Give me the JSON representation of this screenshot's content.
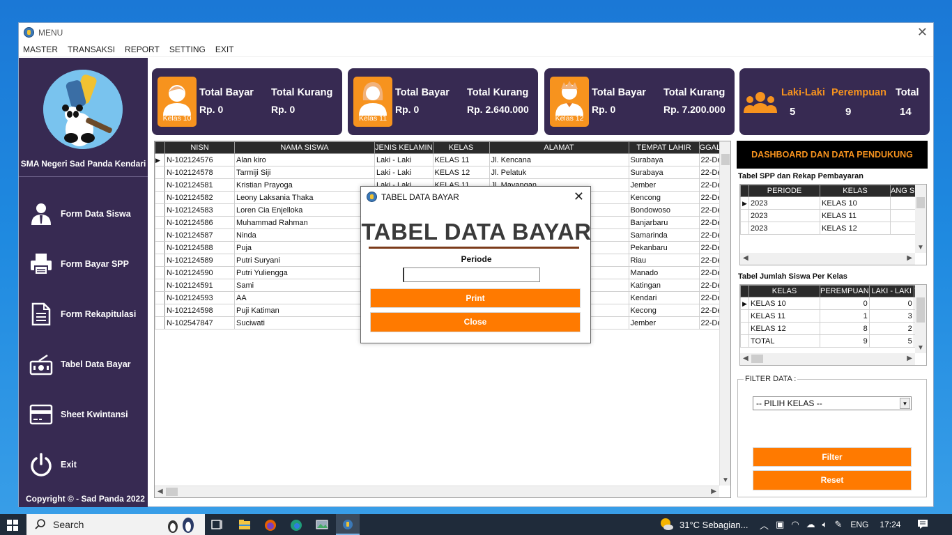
{
  "window": {
    "title": "MENU"
  },
  "menu": [
    "MASTER",
    "TRANSAKSI",
    "REPORT",
    "SETTING",
    "EXIT"
  ],
  "sidebar": {
    "school": "SMA Negeri Sad Panda Kendari",
    "items": [
      {
        "label": "Form Data Siswa",
        "icon": "user-tie-icon"
      },
      {
        "label": "Form Bayar SPP",
        "icon": "printer-icon"
      },
      {
        "label": "Form Rekapitulasi",
        "icon": "document-icon"
      },
      {
        "label": "Tabel Data Bayar",
        "icon": "cash-register-icon"
      },
      {
        "label": "Sheet Kwintansi",
        "icon": "credit-card-icon"
      },
      {
        "label": "Exit",
        "icon": "power-icon"
      }
    ],
    "copyright": "Copyright © - Sad Panda 2022"
  },
  "cards": [
    {
      "badge": "Kelas 10",
      "bayar_label": "Total Bayar",
      "bayar_val": "Rp. 0",
      "kurang_label": "Total Kurang",
      "kurang_val": "Rp. 0"
    },
    {
      "badge": "Kelas 11",
      "bayar_label": "Total Bayar",
      "bayar_val": "Rp. 0",
      "kurang_label": "Total Kurang",
      "kurang_val": "Rp. 2.640.000"
    },
    {
      "badge": "Kelas 12",
      "bayar_label": "Total Bayar",
      "bayar_val": "Rp. 0",
      "kurang_label": "Total Kurang",
      "kurang_val": "Rp. 7.200.000"
    }
  ],
  "gender": {
    "laki_label": "Laki-Laki",
    "laki_val": "5",
    "perempuan_label": "Perempuan",
    "perempuan_val": "9",
    "total_label": "Total",
    "total_val": "14"
  },
  "grid": {
    "headers": [
      "NISN",
      "NAMA SISWA",
      "JENIS KELAMIN",
      "KELAS",
      "ALAMAT",
      "TEMPAT LAHIR",
      "GGAL L"
    ],
    "rows": [
      [
        "N-102124576",
        "Alan kiro",
        "Laki - Laki",
        "KELAS 11",
        "Jl. Kencana",
        "Surabaya",
        "22-De"
      ],
      [
        "N-102124578",
        "Tarmiji Siji",
        "Laki - Laki",
        "KELAS 12",
        "Jl. Pelatuk",
        "Surabaya",
        "22-De"
      ],
      [
        "N-102124581",
        "Kristian Prayoga",
        "Laki - Laki",
        "KELAS 11",
        "Jl. Mayangan",
        "Jember",
        "22-De"
      ],
      [
        "N-102124582",
        "Leony Laksania Thaka",
        "",
        "",
        "",
        "Kencong",
        "22-De"
      ],
      [
        "N-102124583",
        "Loren Cia Enjelloka",
        "",
        "",
        "",
        "Bondowoso",
        "22-De"
      ],
      [
        "N-102124586",
        "Muhammad Rahman",
        "",
        "",
        "",
        "Banjarbaru",
        "22-De"
      ],
      [
        "N-102124587",
        "Ninda",
        "",
        "",
        "",
        "Samarinda",
        "22-De"
      ],
      [
        "N-102124588",
        "Puja",
        "",
        "",
        "",
        "Pekanbaru",
        "22-De"
      ],
      [
        "N-102124589",
        "Putri Suryani",
        "",
        "",
        "",
        "Riau",
        "22-De"
      ],
      [
        "N-102124590",
        "Putri Yuliengga",
        "",
        "",
        "",
        "Manado",
        "22-De"
      ],
      [
        "N-102124591",
        "Sami",
        "",
        "",
        "",
        "Katingan",
        "22-De"
      ],
      [
        "N-102124593",
        "AA",
        "",
        "",
        "",
        "Kendari",
        "22-De"
      ],
      [
        "N-102124598",
        "Puji Katiman",
        "",
        "",
        "",
        "Kecong",
        "22-De"
      ],
      [
        "N-102547847",
        "Suciwati",
        "",
        "",
        "",
        "Jember",
        "22-De"
      ]
    ]
  },
  "right": {
    "dash_title": "DASHBOARD DAN DATA PENDUKUNG",
    "spp_caption": "Tabel SPP dan Rekap Pembayaran",
    "spp_headers": [
      "PERIODE",
      "KELAS",
      "ANG SP"
    ],
    "spp_rows": [
      [
        "2023",
        "KELAS 10"
      ],
      [
        "2023",
        "KELAS 11"
      ],
      [
        "2023",
        "KELAS 12"
      ]
    ],
    "jumlah_caption": "Tabel Jumlah Siswa Per Kelas",
    "jumlah_headers": [
      "KELAS",
      "PEREMPUAN",
      "LAKI - LAKI",
      "T"
    ],
    "jumlah_rows": [
      [
        "KELAS 10",
        "0",
        "0"
      ],
      [
        "KELAS 11",
        "1",
        "3"
      ],
      [
        "KELAS 12",
        "8",
        "2"
      ],
      [
        "TOTAL",
        "9",
        "5"
      ]
    ],
    "filter_legend": "FILTER DATA :",
    "filter_select": "-- PILIH KELAS --",
    "filter_btn": "Filter",
    "reset_btn": "Reset"
  },
  "dialog": {
    "title": "TABEL DATA BAYAR",
    "heading": "TABEL DATA BAYAR",
    "periode_label": "Periode",
    "periode_value": "",
    "print_btn": "Print",
    "close_btn": "Close"
  },
  "taskbar": {
    "search": "Search",
    "weather": "31°C  Sebagian...",
    "lang": "ENG",
    "time": "17:24"
  }
}
